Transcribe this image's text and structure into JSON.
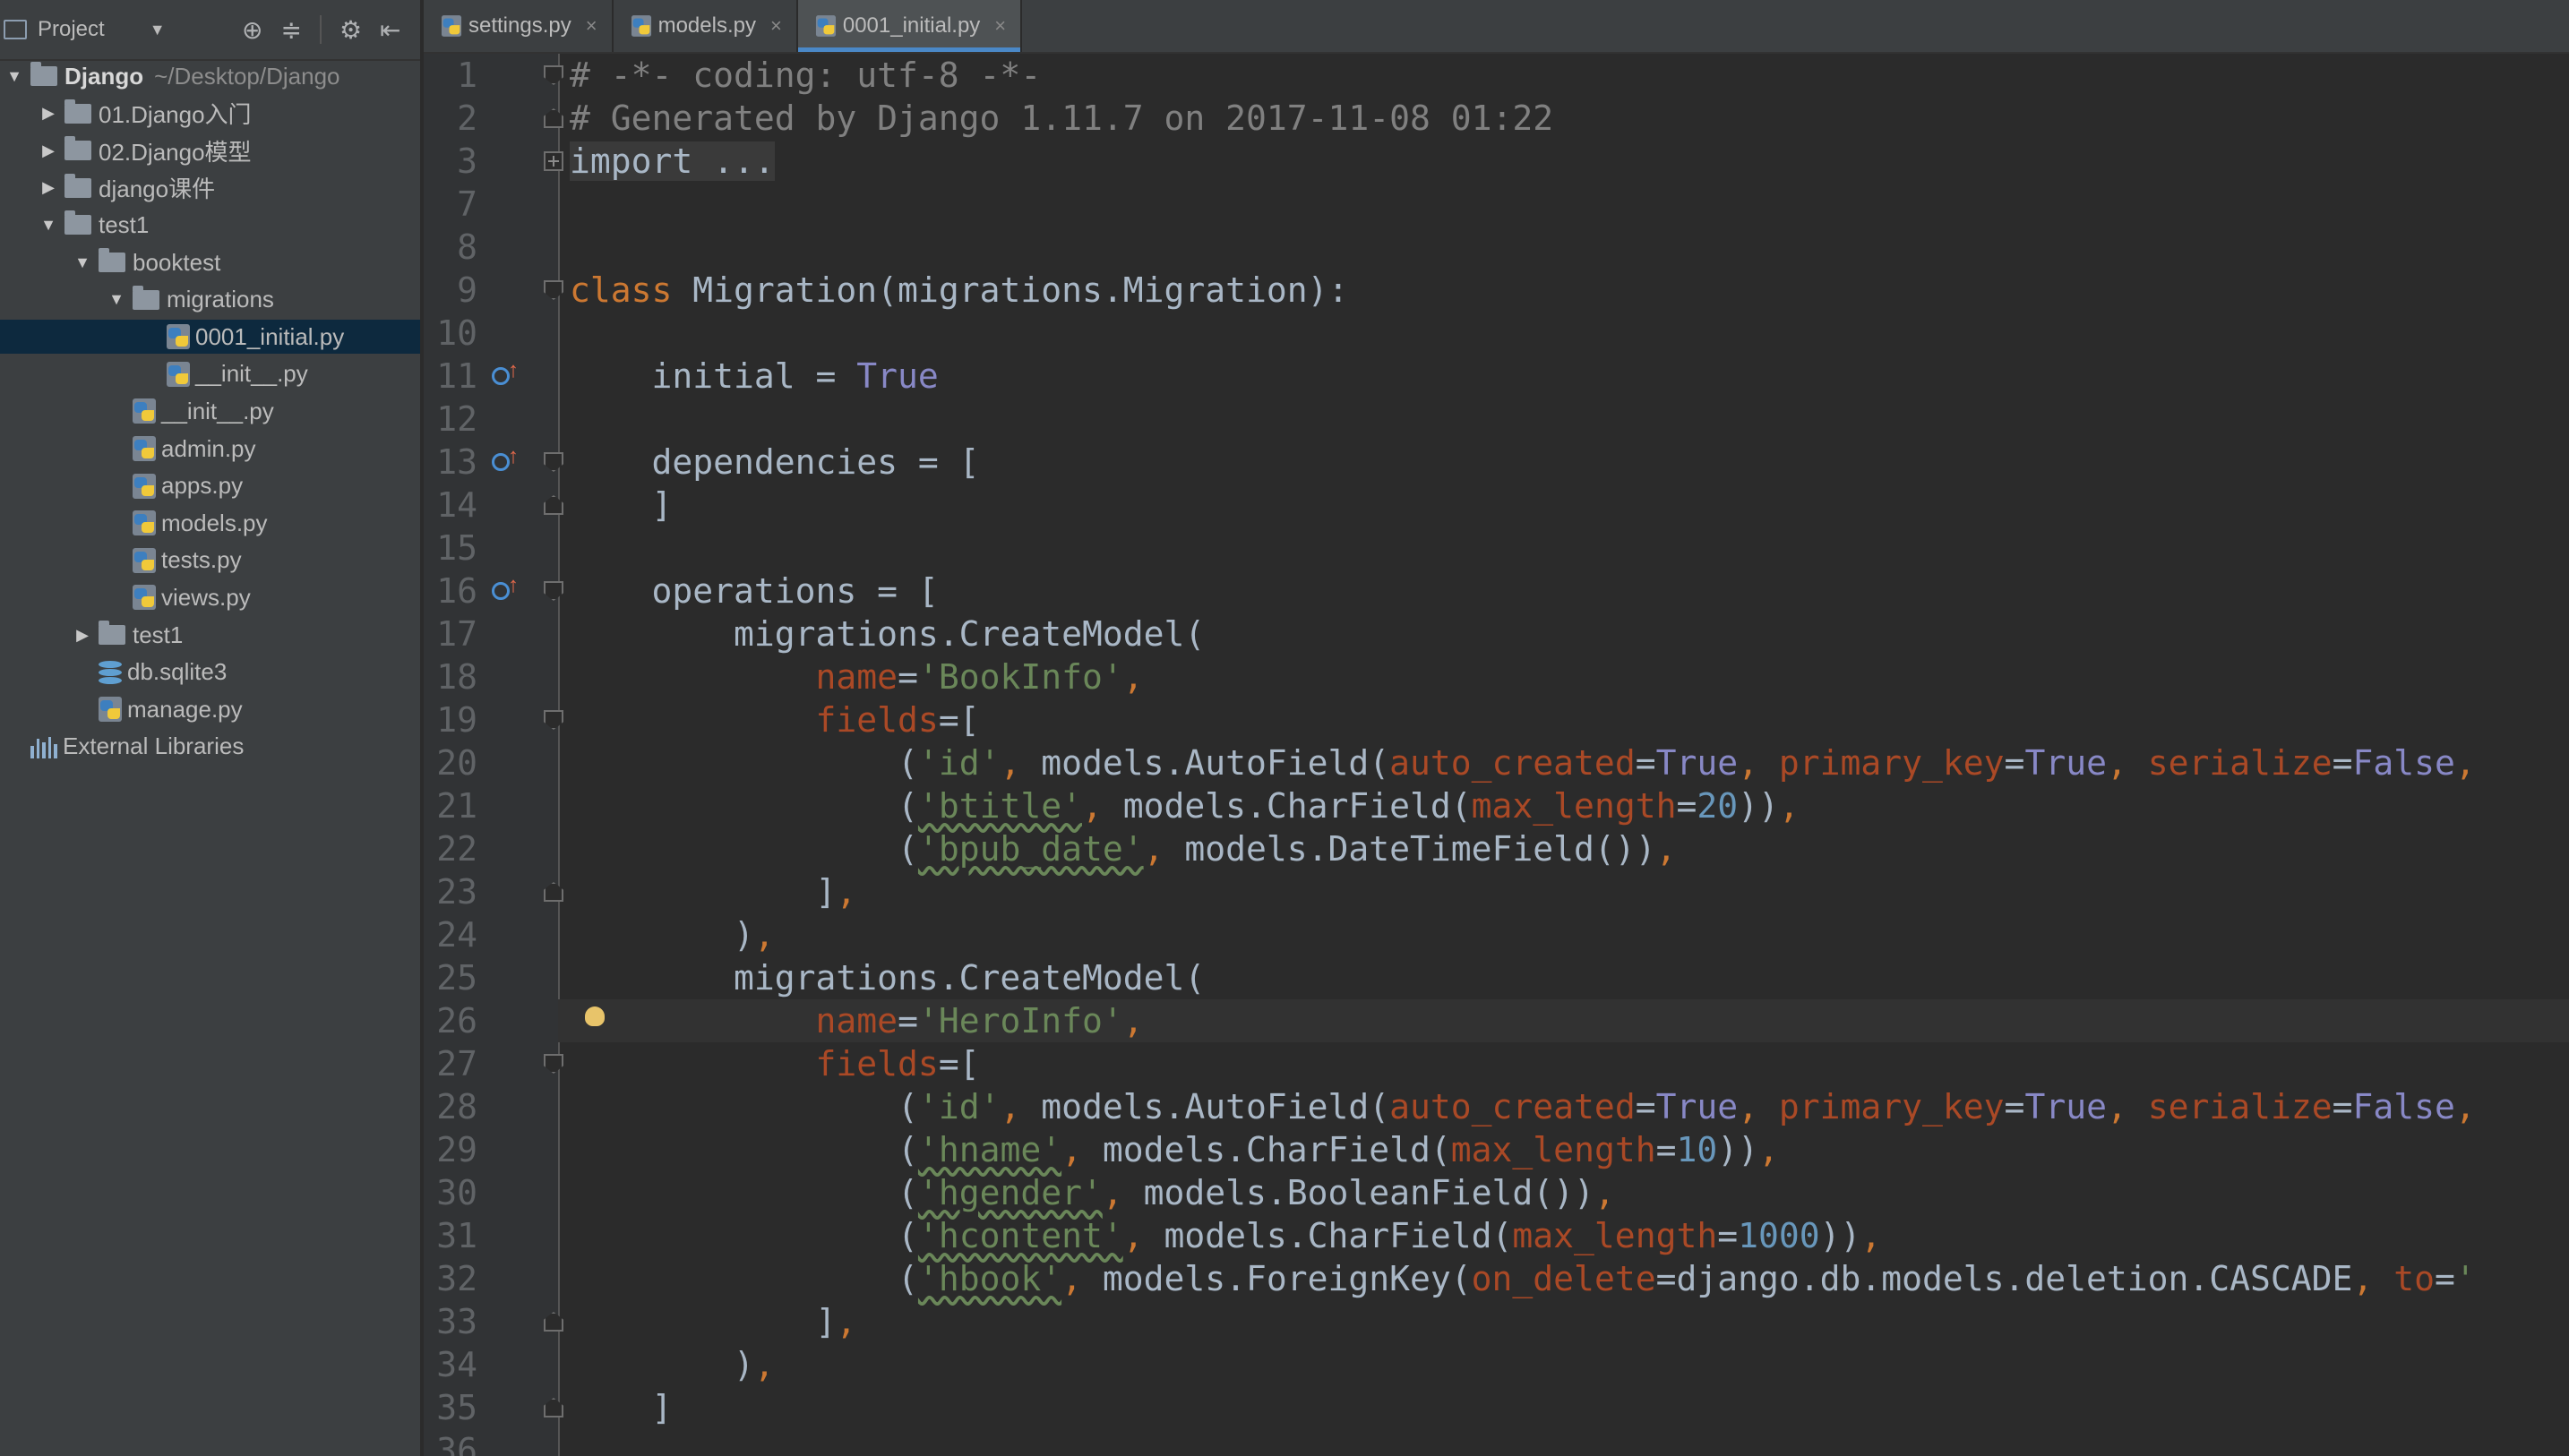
{
  "sidebar": {
    "title": "Project",
    "tree": [
      {
        "label": "Django",
        "hint": "~/Desktop/Django",
        "depth": 0,
        "type": "folder",
        "arrow": "open",
        "bold": true
      },
      {
        "label": "01.Django入门",
        "depth": 1,
        "type": "folder",
        "arrow": "closed"
      },
      {
        "label": "02.Django模型",
        "depth": 1,
        "type": "folder",
        "arrow": "closed"
      },
      {
        "label": "django课件",
        "depth": 1,
        "type": "folder",
        "arrow": "closed"
      },
      {
        "label": "test1",
        "depth": 1,
        "type": "folder",
        "arrow": "open"
      },
      {
        "label": "booktest",
        "depth": 2,
        "type": "folder",
        "arrow": "open"
      },
      {
        "label": "migrations",
        "depth": 3,
        "type": "folder",
        "arrow": "open"
      },
      {
        "label": "0001_initial.py",
        "depth": 4,
        "type": "py",
        "selected": true
      },
      {
        "label": "__init__.py",
        "depth": 4,
        "type": "py"
      },
      {
        "label": "__init__.py",
        "depth": 3,
        "type": "py"
      },
      {
        "label": "admin.py",
        "depth": 3,
        "type": "py"
      },
      {
        "label": "apps.py",
        "depth": 3,
        "type": "py"
      },
      {
        "label": "models.py",
        "depth": 3,
        "type": "py"
      },
      {
        "label": "tests.py",
        "depth": 3,
        "type": "py"
      },
      {
        "label": "views.py",
        "depth": 3,
        "type": "py"
      },
      {
        "label": "test1",
        "depth": 2,
        "type": "folder",
        "arrow": "closed"
      },
      {
        "label": "db.sqlite3",
        "depth": 2,
        "type": "db"
      },
      {
        "label": "manage.py",
        "depth": 2,
        "type": "py"
      },
      {
        "label": "External Libraries",
        "depth": 0,
        "type": "lib"
      }
    ]
  },
  "tabs": [
    {
      "label": "settings.py",
      "active": false
    },
    {
      "label": "models.py",
      "active": false
    },
    {
      "label": "0001_initial.py",
      "active": true
    }
  ],
  "editor": {
    "current_line": 26,
    "lines": [
      {
        "n": "1",
        "fold": "start",
        "tokens": [
          [
            "c-com",
            "# -*- coding: utf-8 -*-"
          ]
        ]
      },
      {
        "n": "2",
        "fold": "end",
        "tokens": [
          [
            "c-com",
            "# Generated by Django 1.11.7 on 2017-11-08 01:22"
          ]
        ]
      },
      {
        "n": "3",
        "fold": "plus",
        "tokens": [
          [
            "c-fold",
            "import ..."
          ]
        ]
      },
      {
        "n": "7",
        "tokens": []
      },
      {
        "n": "8",
        "tokens": []
      },
      {
        "n": "9",
        "fold": "start",
        "tokens": [
          [
            "c-kw",
            "class "
          ],
          [
            "",
            "Migration(migrations.Migration):"
          ]
        ]
      },
      {
        "n": "10",
        "tokens": []
      },
      {
        "n": "11",
        "mark": true,
        "tokens": [
          [
            "",
            "    initial = "
          ],
          [
            "c-true",
            "True"
          ]
        ]
      },
      {
        "n": "12",
        "tokens": []
      },
      {
        "n": "13",
        "mark": true,
        "fold": "start",
        "tokens": [
          [
            "",
            "    dependencies = ["
          ]
        ]
      },
      {
        "n": "14",
        "fold": "end",
        "tokens": [
          [
            "",
            "    ]"
          ]
        ]
      },
      {
        "n": "15",
        "tokens": []
      },
      {
        "n": "16",
        "mark": true,
        "fold": "start",
        "tokens": [
          [
            "",
            "    operations = ["
          ]
        ]
      },
      {
        "n": "17",
        "tokens": [
          [
            "",
            "        migrations.CreateModel("
          ]
        ]
      },
      {
        "n": "18",
        "tokens": [
          [
            "",
            "            "
          ],
          [
            "c-param",
            "name"
          ],
          [
            "",
            "="
          ],
          [
            "c-str",
            "'BookInfo'"
          ],
          [
            "c-kw",
            ","
          ]
        ]
      },
      {
        "n": "19",
        "fold": "start",
        "tokens": [
          [
            "",
            "            "
          ],
          [
            "c-param",
            "fields"
          ],
          [
            "",
            "=["
          ]
        ]
      },
      {
        "n": "20",
        "tokens": [
          [
            "",
            "                ("
          ],
          [
            "c-str",
            "'id'"
          ],
          [
            "c-kw",
            ", "
          ],
          [
            "",
            "models.AutoField("
          ],
          [
            "c-param",
            "auto_created"
          ],
          [
            "",
            "="
          ],
          [
            "c-true",
            "True"
          ],
          [
            "c-kw",
            ", "
          ],
          [
            "c-param",
            "primary_key"
          ],
          [
            "",
            "="
          ],
          [
            "c-true",
            "True"
          ],
          [
            "c-kw",
            ", "
          ],
          [
            "c-param",
            "serialize"
          ],
          [
            "",
            "="
          ],
          [
            "c-true",
            "False"
          ],
          [
            "c-kw",
            ","
          ]
        ]
      },
      {
        "n": "21",
        "tokens": [
          [
            "",
            "                ("
          ],
          [
            "c-str c-sq",
            "'btitle'"
          ],
          [
            "c-kw",
            ", "
          ],
          [
            "",
            "models.CharField("
          ],
          [
            "c-param",
            "max_length"
          ],
          [
            "",
            "="
          ],
          [
            "c-num",
            "20"
          ],
          [
            "",
            "))"
          ],
          [
            "c-kw",
            ","
          ]
        ]
      },
      {
        "n": "22",
        "tokens": [
          [
            "",
            "                ("
          ],
          [
            "c-str c-sq",
            "'bpub_date'"
          ],
          [
            "c-kw",
            ", "
          ],
          [
            "",
            "models.DateTimeField())"
          ],
          [
            "c-kw",
            ","
          ]
        ]
      },
      {
        "n": "23",
        "fold": "end",
        "tokens": [
          [
            "",
            "            ]"
          ],
          [
            "c-kw",
            ","
          ]
        ]
      },
      {
        "n": "24",
        "tokens": [
          [
            "",
            "        )"
          ],
          [
            "c-kw",
            ","
          ]
        ]
      },
      {
        "n": "25",
        "tokens": [
          [
            "",
            "        migrations.CreateModel("
          ]
        ]
      },
      {
        "n": "26",
        "bulb": true,
        "tokens": [
          [
            "",
            "            "
          ],
          [
            "c-param",
            "name"
          ],
          [
            "",
            "="
          ],
          [
            "c-str",
            "'HeroInfo'"
          ],
          [
            "c-kw",
            ","
          ]
        ]
      },
      {
        "n": "27",
        "fold": "start",
        "tokens": [
          [
            "",
            "            "
          ],
          [
            "c-param",
            "fields"
          ],
          [
            "",
            "=["
          ]
        ]
      },
      {
        "n": "28",
        "tokens": [
          [
            "",
            "                ("
          ],
          [
            "c-str",
            "'id'"
          ],
          [
            "c-kw",
            ", "
          ],
          [
            "",
            "models.AutoField("
          ],
          [
            "c-param",
            "auto_created"
          ],
          [
            "",
            "="
          ],
          [
            "c-true",
            "True"
          ],
          [
            "c-kw",
            ", "
          ],
          [
            "c-param",
            "primary_key"
          ],
          [
            "",
            "="
          ],
          [
            "c-true",
            "True"
          ],
          [
            "c-kw",
            ", "
          ],
          [
            "c-param",
            "serialize"
          ],
          [
            "",
            "="
          ],
          [
            "c-true",
            "False"
          ],
          [
            "c-kw",
            ","
          ]
        ]
      },
      {
        "n": "29",
        "tokens": [
          [
            "",
            "                ("
          ],
          [
            "c-str c-sq",
            "'hname'"
          ],
          [
            "c-kw",
            ", "
          ],
          [
            "",
            "models.CharField("
          ],
          [
            "c-param",
            "max_length"
          ],
          [
            "",
            "="
          ],
          [
            "c-num",
            "10"
          ],
          [
            "",
            "))"
          ],
          [
            "c-kw",
            ","
          ]
        ]
      },
      {
        "n": "30",
        "tokens": [
          [
            "",
            "                ("
          ],
          [
            "c-str c-sq",
            "'hgender'"
          ],
          [
            "c-kw",
            ", "
          ],
          [
            "",
            "models.BooleanField())"
          ],
          [
            "c-kw",
            ","
          ]
        ]
      },
      {
        "n": "31",
        "tokens": [
          [
            "",
            "                ("
          ],
          [
            "c-str c-sq",
            "'hcontent'"
          ],
          [
            "c-kw",
            ", "
          ],
          [
            "",
            "models.CharField("
          ],
          [
            "c-param",
            "max_length"
          ],
          [
            "",
            "="
          ],
          [
            "c-num",
            "1000"
          ],
          [
            "",
            "))"
          ],
          [
            "c-kw",
            ","
          ]
        ]
      },
      {
        "n": "32",
        "tokens": [
          [
            "",
            "                ("
          ],
          [
            "c-str c-sq",
            "'hbook'"
          ],
          [
            "c-kw",
            ", "
          ],
          [
            "",
            "models.ForeignKey("
          ],
          [
            "c-param",
            "on_delete"
          ],
          [
            "",
            "=django.db.models.deletion.CASCADE"
          ],
          [
            "c-kw",
            ", "
          ],
          [
            "c-param",
            "to"
          ],
          [
            "",
            "="
          ],
          [
            "c-str",
            "'"
          ]
        ]
      },
      {
        "n": "33",
        "fold": "end",
        "tokens": [
          [
            "",
            "            ]"
          ],
          [
            "c-kw",
            ","
          ]
        ]
      },
      {
        "n": "34",
        "tokens": [
          [
            "",
            "        )"
          ],
          [
            "c-kw",
            ","
          ]
        ]
      },
      {
        "n": "35",
        "fold": "end",
        "tokens": [
          [
            "",
            "    ]"
          ]
        ]
      },
      {
        "n": "36",
        "tokens": []
      }
    ]
  }
}
